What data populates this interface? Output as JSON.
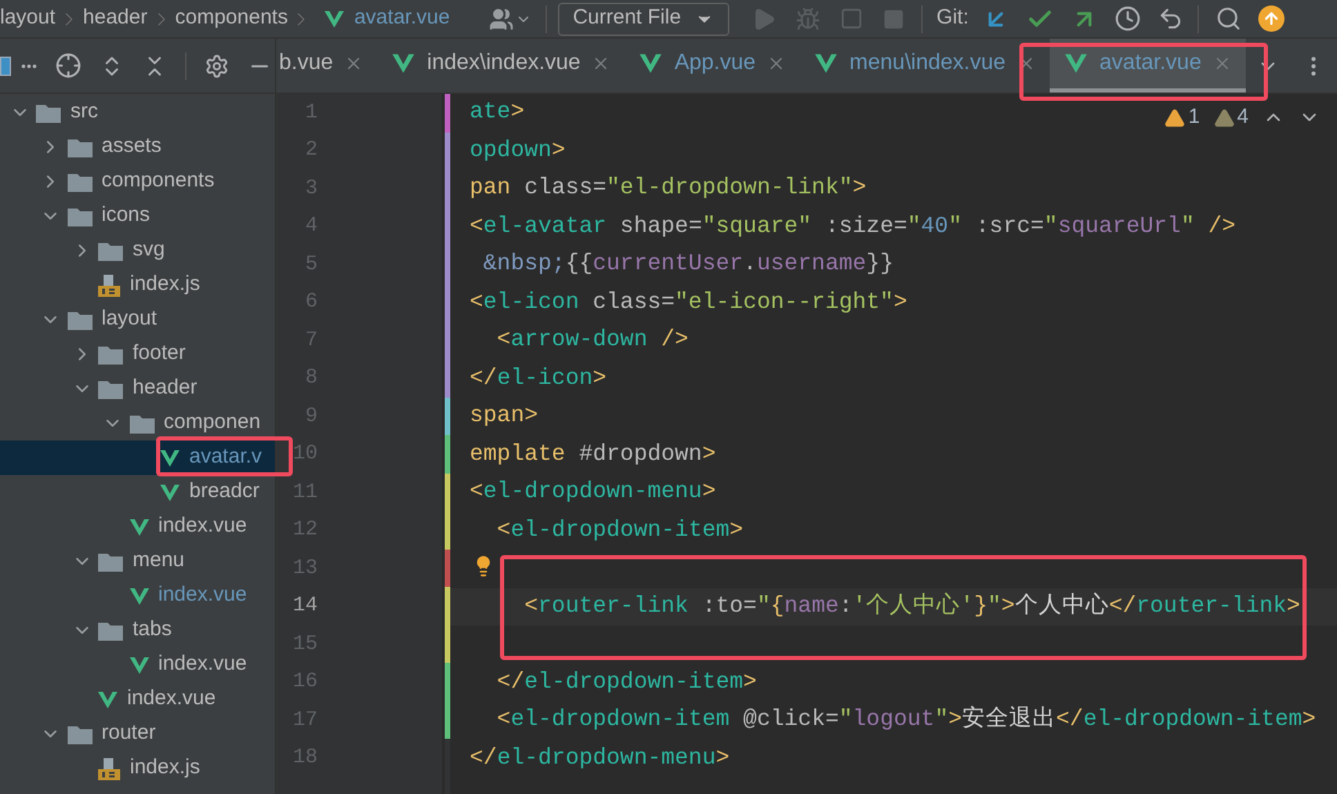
{
  "breadcrumbs": [
    {
      "label": "layout",
      "kind": "folder"
    },
    {
      "label": "header",
      "kind": "folder"
    },
    {
      "label": "components",
      "kind": "folder"
    },
    {
      "label": "avatar.vue",
      "kind": "vue"
    }
  ],
  "toolbar": {
    "run_config": "Current File",
    "vcs_label": "Git:"
  },
  "tabs": [
    {
      "label": "b.vue",
      "kind": "plain",
      "selected": false,
      "modified": false
    },
    {
      "label": "index\\index.vue",
      "kind": "vue",
      "selected": false,
      "modified": false
    },
    {
      "label": "App.vue",
      "kind": "vue",
      "selected": false,
      "modified": true
    },
    {
      "label": "menu\\index.vue",
      "kind": "vue",
      "selected": false,
      "modified": true
    },
    {
      "label": "avatar.vue",
      "kind": "vue",
      "selected": true,
      "modified": true
    }
  ],
  "tree": [
    {
      "label": "src",
      "kind": "folder",
      "expanded": true,
      "selected": false,
      "children": [
        {
          "label": "assets",
          "kind": "folder",
          "expanded": false,
          "selected": false
        },
        {
          "label": "components",
          "kind": "folder",
          "expanded": false,
          "selected": false
        },
        {
          "label": "icons",
          "kind": "folder",
          "expanded": true,
          "selected": false,
          "children": [
            {
              "label": "svg",
              "kind": "folder",
              "expanded": false,
              "selected": false
            },
            {
              "label": "index.js",
              "kind": "js",
              "selected": false,
              "modified": false
            }
          ]
        },
        {
          "label": "layout",
          "kind": "folder",
          "expanded": true,
          "selected": false,
          "children": [
            {
              "label": "footer",
              "kind": "folder",
              "expanded": false,
              "selected": false
            },
            {
              "label": "header",
              "kind": "folder",
              "expanded": true,
              "selected": false,
              "children": [
                {
                  "label": "componen",
                  "kind": "folder",
                  "expanded": true,
                  "selected": false,
                  "children": [
                    {
                      "label": "avatar.v",
                      "kind": "vue",
                      "selected": true,
                      "modified": true
                    },
                    {
                      "label": "breadcr",
                      "kind": "vue",
                      "selected": false,
                      "modified": false
                    }
                  ]
                },
                {
                  "label": "index.vue",
                  "kind": "vue",
                  "selected": false,
                  "modified": false
                }
              ]
            },
            {
              "label": "menu",
              "kind": "folder",
              "expanded": true,
              "selected": false,
              "children": [
                {
                  "label": "index.vue",
                  "kind": "vue",
                  "selected": false,
                  "modified": true
                }
              ]
            },
            {
              "label": "tabs",
              "kind": "folder",
              "expanded": true,
              "selected": false,
              "children": [
                {
                  "label": "index.vue",
                  "kind": "vue",
                  "selected": false,
                  "modified": false
                }
              ]
            },
            {
              "label": "index.vue",
              "kind": "vue",
              "selected": false,
              "modified": false
            }
          ]
        },
        {
          "label": "router",
          "kind": "folder",
          "expanded": true,
          "selected": false,
          "children": [
            {
              "label": "index.js",
              "kind": "js",
              "selected": false,
              "modified": false
            }
          ]
        }
      ]
    }
  ],
  "editor": {
    "warnings": "1",
    "weak_warnings": "4",
    "lines": [
      {
        "number": "1",
        "current": false,
        "bulb": false,
        "segments": [
          {
            "kind": "tag",
            "text": "ate"
          },
          {
            "kind": "bracket",
            "text": ">"
          }
        ]
      },
      {
        "number": "2",
        "current": false,
        "bulb": false,
        "segments": [
          {
            "kind": "tag",
            "text": "opdown"
          },
          {
            "kind": "bracket",
            "text": ">"
          }
        ]
      },
      {
        "number": "3",
        "current": false,
        "bulb": false,
        "segments": [
          {
            "kind": "bracket",
            "text": "pan"
          },
          {
            "kind": "attr",
            "text": " class="
          },
          {
            "kind": "string",
            "text": "\"el-dropdown-link\""
          },
          {
            "kind": "bracket",
            "text": ">"
          }
        ]
      },
      {
        "number": "4",
        "current": false,
        "bulb": false,
        "segments": [
          {
            "kind": "bracket",
            "text": "<"
          },
          {
            "kind": "tag",
            "text": "el-avatar"
          },
          {
            "kind": "attr",
            "text": " shape="
          },
          {
            "kind": "string",
            "text": "\"square\""
          },
          {
            "kind": "attr",
            "text": " :size="
          },
          {
            "kind": "string",
            "text": "\""
          },
          {
            "kind": "number",
            "text": "40"
          },
          {
            "kind": "string",
            "text": "\""
          },
          {
            "kind": "attr",
            "text": " :src="
          },
          {
            "kind": "string",
            "text": "\""
          },
          {
            "kind": "var",
            "text": "squareUrl"
          },
          {
            "kind": "string",
            "text": "\""
          },
          {
            "kind": "bracket",
            "text": " />"
          }
        ]
      },
      {
        "number": "5",
        "current": false,
        "bulb": false,
        "segments": [
          {
            "kind": "entity",
            "text": " &nbsp;"
          },
          {
            "kind": "attr",
            "text": "{{"
          },
          {
            "kind": "var",
            "text": "currentUser"
          },
          {
            "kind": "attr",
            "text": "."
          },
          {
            "kind": "var",
            "text": "username"
          },
          {
            "kind": "attr",
            "text": "}}"
          }
        ]
      },
      {
        "number": "6",
        "current": false,
        "bulb": false,
        "segments": [
          {
            "kind": "bracket",
            "text": "<"
          },
          {
            "kind": "tag",
            "text": "el-icon"
          },
          {
            "kind": "attr",
            "text": " class="
          },
          {
            "kind": "string",
            "text": "\"el-icon--right\""
          },
          {
            "kind": "bracket",
            "text": ">"
          }
        ]
      },
      {
        "number": "7",
        "current": false,
        "bulb": false,
        "segments": [
          {
            "kind": "bracket",
            "text": "  <"
          },
          {
            "kind": "tag",
            "text": "arrow-down"
          },
          {
            "kind": "bracket",
            "text": " />"
          }
        ]
      },
      {
        "number": "8",
        "current": false,
        "bulb": false,
        "segments": [
          {
            "kind": "bracket",
            "text": "</"
          },
          {
            "kind": "tag",
            "text": "el-icon"
          },
          {
            "kind": "bracket",
            "text": ">"
          }
        ]
      },
      {
        "number": "9",
        "current": false,
        "bulb": false,
        "segments": [
          {
            "kind": "bracket",
            "text": "span>"
          }
        ]
      },
      {
        "number": "10",
        "current": false,
        "bulb": false,
        "segments": [
          {
            "kind": "bracket",
            "text": "emplate"
          },
          {
            "kind": "attr",
            "text": " #dropdown"
          },
          {
            "kind": "bracket",
            "text": ">"
          }
        ]
      },
      {
        "number": "11",
        "current": false,
        "bulb": false,
        "segments": [
          {
            "kind": "bracket",
            "text": "<"
          },
          {
            "kind": "tag",
            "text": "el-dropdown-menu"
          },
          {
            "kind": "bracket",
            "text": ">"
          }
        ]
      },
      {
        "number": "12",
        "current": false,
        "bulb": false,
        "segments": [
          {
            "kind": "bracket",
            "text": "  <"
          },
          {
            "kind": "tag",
            "text": "el-dropdown-item"
          },
          {
            "kind": "bracket",
            "text": ">"
          }
        ]
      },
      {
        "number": "13",
        "current": false,
        "bulb": true
      },
      {
        "number": "14",
        "current": true,
        "bulb": false,
        "segments": [
          {
            "kind": "bracket",
            "text": "    <"
          },
          {
            "kind": "tag",
            "text": "router-link"
          },
          {
            "kind": "attr",
            "text": " :to="
          },
          {
            "kind": "string",
            "text": "\""
          },
          {
            "kind": "bracket",
            "text": "{"
          },
          {
            "kind": "var",
            "text": "name"
          },
          {
            "kind": "attr",
            "text": ":"
          },
          {
            "kind": "string",
            "text": "'个人中心'"
          },
          {
            "kind": "bracket",
            "text": "}"
          },
          {
            "kind": "string",
            "text": "\""
          },
          {
            "kind": "bracket",
            "text": ">"
          },
          {
            "kind": "text",
            "text": "个人中心"
          },
          {
            "kind": "bracket",
            "text": "</"
          },
          {
            "kind": "tag",
            "text": "router-link"
          },
          {
            "kind": "bracket",
            "text": ">"
          }
        ]
      },
      {
        "number": "15",
        "current": false,
        "bulb": false
      },
      {
        "number": "16",
        "current": false,
        "bulb": false,
        "segments": [
          {
            "kind": "bracket",
            "text": "  </"
          },
          {
            "kind": "tag",
            "text": "el-dropdown-item"
          },
          {
            "kind": "bracket",
            "text": ">"
          }
        ]
      },
      {
        "number": "17",
        "current": false,
        "bulb": false,
        "segments": [
          {
            "kind": "bracket",
            "text": "  <"
          },
          {
            "kind": "tag",
            "text": "el-dropdown-item"
          },
          {
            "kind": "attr",
            "text": " @click="
          },
          {
            "kind": "string",
            "text": "\""
          },
          {
            "kind": "var",
            "text": "logout"
          },
          {
            "kind": "string",
            "text": "\""
          },
          {
            "kind": "bracket",
            "text": ">"
          },
          {
            "kind": "text",
            "text": "安全退出"
          },
          {
            "kind": "bracket",
            "text": "</"
          },
          {
            "kind": "tag",
            "text": "el-dropdown-item"
          },
          {
            "kind": "bracket",
            "text": ">"
          }
        ]
      },
      {
        "number": "18",
        "current": false,
        "bulb": false,
        "segments": [
          {
            "kind": "bracket",
            "text": "</"
          },
          {
            "kind": "tag",
            "text": "el-dropdown-menu"
          },
          {
            "kind": "bracket",
            "text": ">"
          }
        ]
      }
    ]
  }
}
